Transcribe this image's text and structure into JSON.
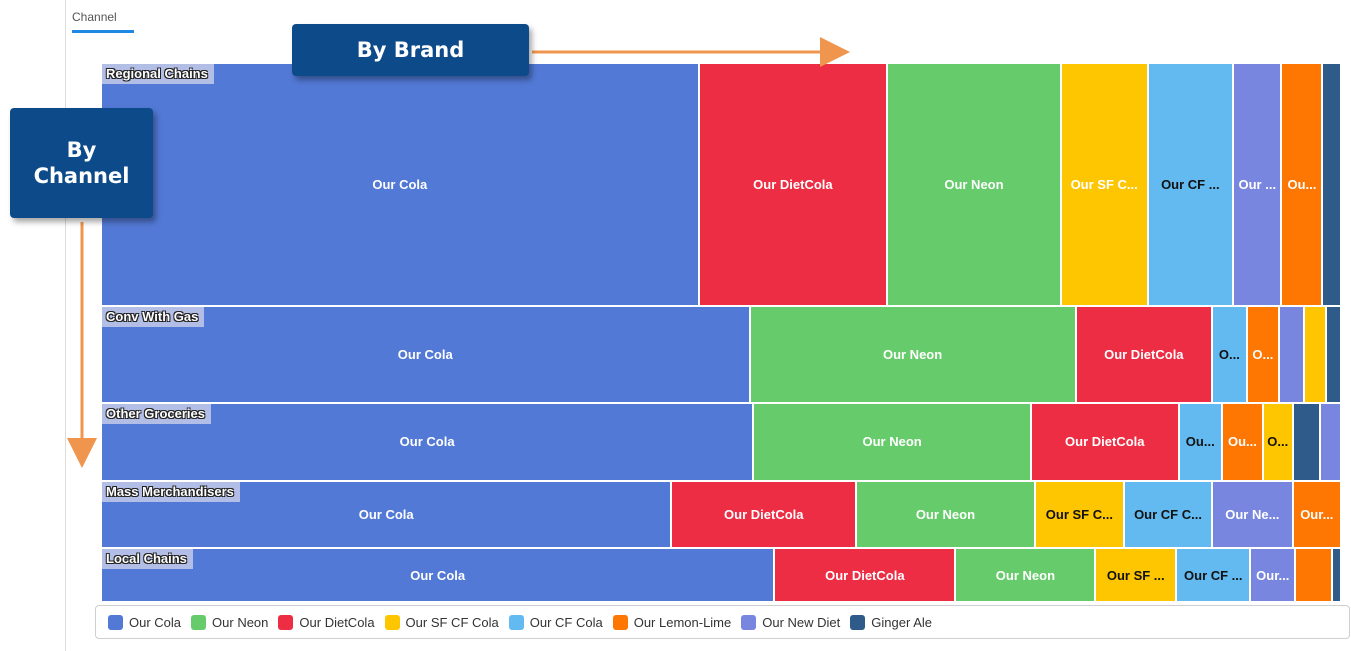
{
  "header": {
    "tab_label": "Channel"
  },
  "callouts": {
    "by_brand": "By Brand",
    "by_channel_line1": "By",
    "by_channel_line2": "Channel"
  },
  "chart_data": {
    "type": "treemap",
    "colors": {
      "Our Cola": "#5279d5",
      "Our Neon": "#66cc6b",
      "Our DietCola": "#ed2d44",
      "Our SF CF Cola": "#fec600",
      "Our CF Cola": "#63baf0",
      "Our Lemon-Lime": "#fd7702",
      "Our New Diet": "#7886e0",
      "Ginger Ale": "#2f5b8b"
    },
    "groups": [
      {
        "name": "Regional Chains",
        "share": 0.45,
        "items": [
          {
            "brand": "Our Cola",
            "share": 0.482,
            "label": "Our Cola"
          },
          {
            "brand": "Our DietCola",
            "share": 0.152,
            "label": "Our DietCola"
          },
          {
            "brand": "Our Neon",
            "share": 0.14,
            "label": "Our Neon"
          },
          {
            "brand": "Our SF CF Cola",
            "share": 0.07,
            "label": "Our SF C..."
          },
          {
            "brand": "Our CF Cola",
            "share": 0.069,
            "label": "Our CF ..."
          },
          {
            "brand": "Our New Diet",
            "share": 0.039,
            "label": "Our ..."
          },
          {
            "brand": "Our Lemon-Lime",
            "share": 0.033,
            "label": "Ou..."
          },
          {
            "brand": "Ginger Ale",
            "share": 0.015,
            "label": ""
          }
        ]
      },
      {
        "name": "Conv With Gas",
        "share": 0.18,
        "items": [
          {
            "brand": "Our Cola",
            "share": 0.523,
            "label": "Our Cola"
          },
          {
            "brand": "Our Neon",
            "share": 0.263,
            "label": "Our Neon"
          },
          {
            "brand": "Our DietCola",
            "share": 0.11,
            "label": "Our DietCola"
          },
          {
            "brand": "Our CF Cola",
            "share": 0.028,
            "label": "O..."
          },
          {
            "brand": "Our Lemon-Lime",
            "share": 0.026,
            "label": "O..."
          },
          {
            "brand": "Our New Diet",
            "share": 0.02,
            "label": ""
          },
          {
            "brand": "Our SF CF Cola",
            "share": 0.018,
            "label": ""
          },
          {
            "brand": "Ginger Ale",
            "share": 0.012,
            "label": ""
          }
        ]
      },
      {
        "name": "Other Groceries",
        "share": 0.145,
        "items": [
          {
            "brand": "Our Cola",
            "share": 0.526,
            "label": "Our Cola"
          },
          {
            "brand": "Our Neon",
            "share": 0.224,
            "label": "Our Neon"
          },
          {
            "brand": "Our DietCola",
            "share": 0.119,
            "label": "Our DietCola"
          },
          {
            "brand": "Our CF Cola",
            "share": 0.035,
            "label": "Ou..."
          },
          {
            "brand": "Our Lemon-Lime",
            "share": 0.033,
            "label": "Ou..."
          },
          {
            "brand": "Our SF CF Cola",
            "share": 0.024,
            "label": "O..."
          },
          {
            "brand": "Ginger Ale",
            "share": 0.022,
            "label": ""
          },
          {
            "brand": "Our New Diet",
            "share": 0.017,
            "label": ""
          }
        ]
      },
      {
        "name": "Mass Merchandisers",
        "share": 0.125,
        "items": [
          {
            "brand": "Our Cola",
            "share": 0.46,
            "label": "Our Cola"
          },
          {
            "brand": "Our DietCola",
            "share": 0.149,
            "label": "Our DietCola"
          },
          {
            "brand": "Our Neon",
            "share": 0.144,
            "label": "Our Neon"
          },
          {
            "brand": "Our SF CF Cola",
            "share": 0.072,
            "label": "Our SF C..."
          },
          {
            "brand": "Our CF Cola",
            "share": 0.071,
            "label": "Our CF C..."
          },
          {
            "brand": "Our New Diet",
            "share": 0.065,
            "label": "Our Ne..."
          },
          {
            "brand": "Our Lemon-Lime",
            "share": 0.039,
            "label": "Our..."
          }
        ]
      },
      {
        "name": "Local Chains",
        "share": 0.1,
        "items": [
          {
            "brand": "Our Cola",
            "share": 0.543,
            "label": "Our Cola"
          },
          {
            "brand": "Our DietCola",
            "share": 0.146,
            "label": "Our DietCola"
          },
          {
            "brand": "Our Neon",
            "share": 0.113,
            "label": "Our Neon"
          },
          {
            "brand": "Our SF CF Cola",
            "share": 0.065,
            "label": "Our SF ..."
          },
          {
            "brand": "Our CF Cola",
            "share": 0.06,
            "label": "Our CF ..."
          },
          {
            "brand": "Our New Diet",
            "share": 0.036,
            "label": "Our..."
          },
          {
            "brand": "Our Lemon-Lime",
            "share": 0.03,
            "label": ""
          },
          {
            "brand": "Ginger Ale",
            "share": 0.007,
            "label": ""
          }
        ]
      }
    ],
    "legend": [
      "Our Cola",
      "Our Neon",
      "Our DietCola",
      "Our SF CF Cola",
      "Our CF Cola",
      "Our Lemon-Lime",
      "Our New Diet",
      "Ginger Ale"
    ],
    "legend_position": "bottom"
  }
}
